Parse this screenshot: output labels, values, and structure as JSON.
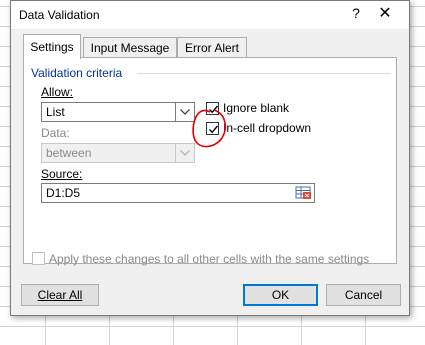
{
  "window": {
    "title": "Data Validation"
  },
  "tabs": [
    {
      "label": "Settings",
      "active": true
    },
    {
      "label": "Input Message",
      "active": false
    },
    {
      "label": "Error Alert",
      "active": false
    }
  ],
  "criteria": {
    "group_label": "Validation criteria",
    "allow_label": "Allow:",
    "allow_value": "List",
    "data_label": "Data:",
    "data_value": "between",
    "ignore_blank_label": "Ignore blank",
    "ignore_blank_checked": true,
    "in_cell_dropdown_label": "In-cell dropdown",
    "in_cell_dropdown_checked": true,
    "source_label": "Source:",
    "source_value": "D1:D5"
  },
  "apply_all": {
    "label": "Apply these changes to all other cells with the same settings",
    "checked": false
  },
  "buttons": {
    "clear_all": "Clear All",
    "ok": "OK",
    "cancel": "Cancel"
  },
  "colors": {
    "accent": "#0078d7",
    "group_label": "#003399",
    "annotation": "#e00000"
  }
}
